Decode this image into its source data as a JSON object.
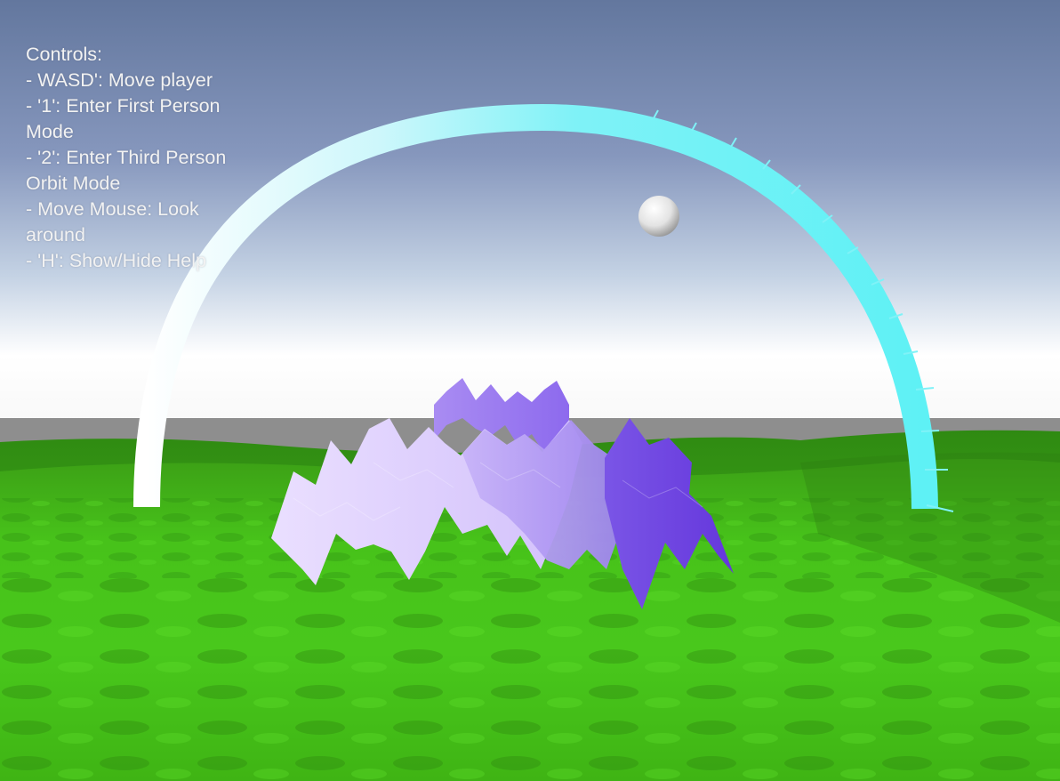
{
  "help": {
    "title": "Controls:",
    "lines": [
      "- WASD': Move player",
      "- '1': Enter First Person Mode",
      "- '2': Enter Third Person Orbit Mode",
      "- Move Mouse: Look around",
      "- 'H': Show/Hide Help"
    ]
  },
  "scene": {
    "sky_top_color": "#6478a0",
    "sky_horizon_color": "#ffffff",
    "ground_color": "#44c418",
    "arch_color": "#6ff4f7",
    "terrain_mesh_colors": [
      "#e7d9ff",
      "#9a7cf0",
      "#6a3fe0"
    ],
    "sphere_color": "#efefef"
  }
}
